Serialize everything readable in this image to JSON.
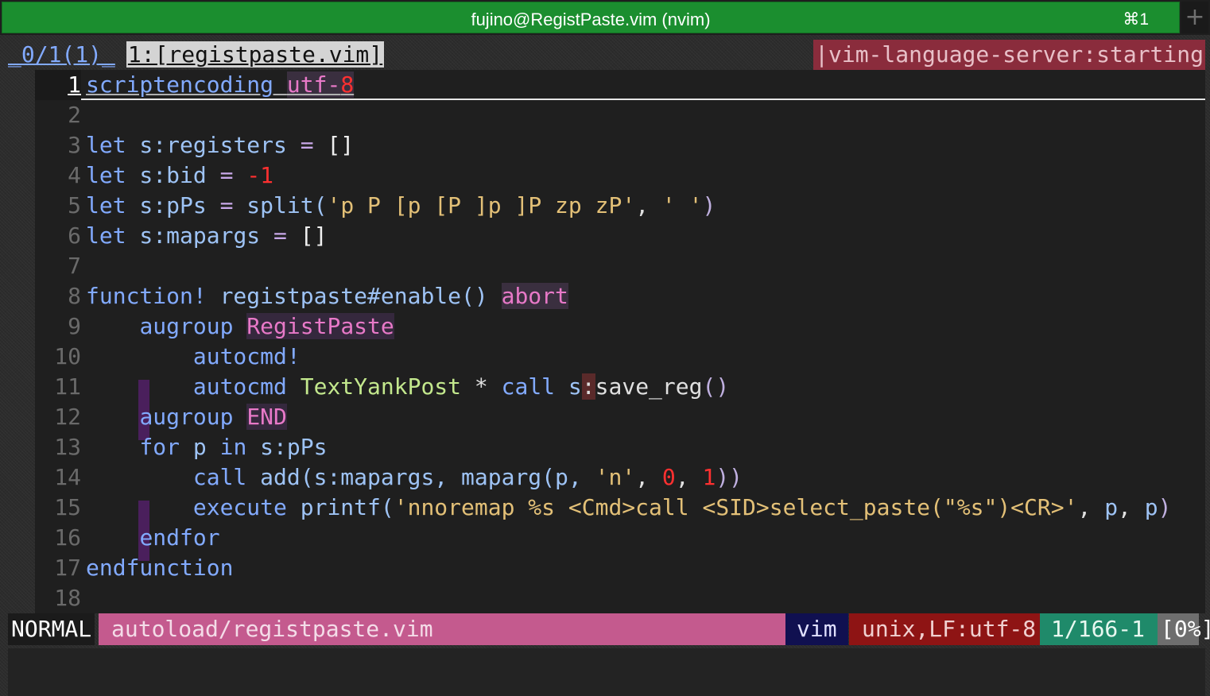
{
  "window": {
    "title": "fujino@RegistPaste.vim (nvim)",
    "shortcut": "⌘1",
    "new_tab_glyph": "+"
  },
  "tabline": {
    "buffers": "_0/1(1)_",
    "active_tab": "1:[registpaste.vim]",
    "lsp_status": "|vim-language-server:starting"
  },
  "editor": {
    "lines": [
      {
        "n": "1"
      },
      {
        "n": "2"
      },
      {
        "n": "3"
      },
      {
        "n": "4"
      },
      {
        "n": "5"
      },
      {
        "n": "6"
      },
      {
        "n": "7"
      },
      {
        "n": "8"
      },
      {
        "n": "9"
      },
      {
        "n": "10"
      },
      {
        "n": "11"
      },
      {
        "n": "12"
      },
      {
        "n": "13"
      },
      {
        "n": "14"
      },
      {
        "n": "15"
      },
      {
        "n": "16"
      },
      {
        "n": "17"
      },
      {
        "n": "18"
      }
    ],
    "code": {
      "l1": [
        "scriptencoding",
        " ",
        "utf-",
        "8"
      ],
      "l3": [
        "let",
        " s:registers ",
        "=",
        " ",
        "[]"
      ],
      "l4": [
        "let",
        " s:bid ",
        "=",
        " ",
        "-1"
      ],
      "l5": [
        "let",
        " s:pPs ",
        "=",
        " split(",
        "'p P [p [P ]p ]P zp zP'",
        ", ",
        "' '",
        ")"
      ],
      "l6": [
        "let",
        " s:mapargs ",
        "=",
        " ",
        "[]"
      ],
      "l8": [
        "function!",
        " registpaste#enable() ",
        "abort"
      ],
      "l9": [
        "augroup",
        " ",
        "RegistPaste"
      ],
      "l10": [
        "autocmd!"
      ],
      "l11": [
        "autocmd",
        " ",
        "TextYankPost",
        " * ",
        "call",
        " ",
        "s",
        ":",
        "save_reg",
        "()"
      ],
      "l12": [
        "augroup",
        " ",
        "END"
      ],
      "l13": [
        "for",
        " p ",
        "in",
        " s:pPs"
      ],
      "l14": [
        "call",
        " add(s:mapargs, maparg(p, ",
        "'n'",
        ", ",
        "0",
        ", ",
        "1",
        "))"
      ],
      "l15": [
        "execute",
        " printf(",
        "'nnoremap %s <Cmd>call <SID>select_paste(\"%s\")<CR>'",
        ", ",
        "p",
        ", ",
        "p",
        ")"
      ],
      "l16": [
        "endfor"
      ],
      "l17": [
        "endfunction"
      ]
    }
  },
  "statusline": {
    "mode": "NORMAL",
    "file": "autoload/registpaste.vim",
    "filetype": "vim",
    "encoding": "unix,LF:utf-8",
    "position": "1/166-1",
    "percent": "[0%]"
  }
}
